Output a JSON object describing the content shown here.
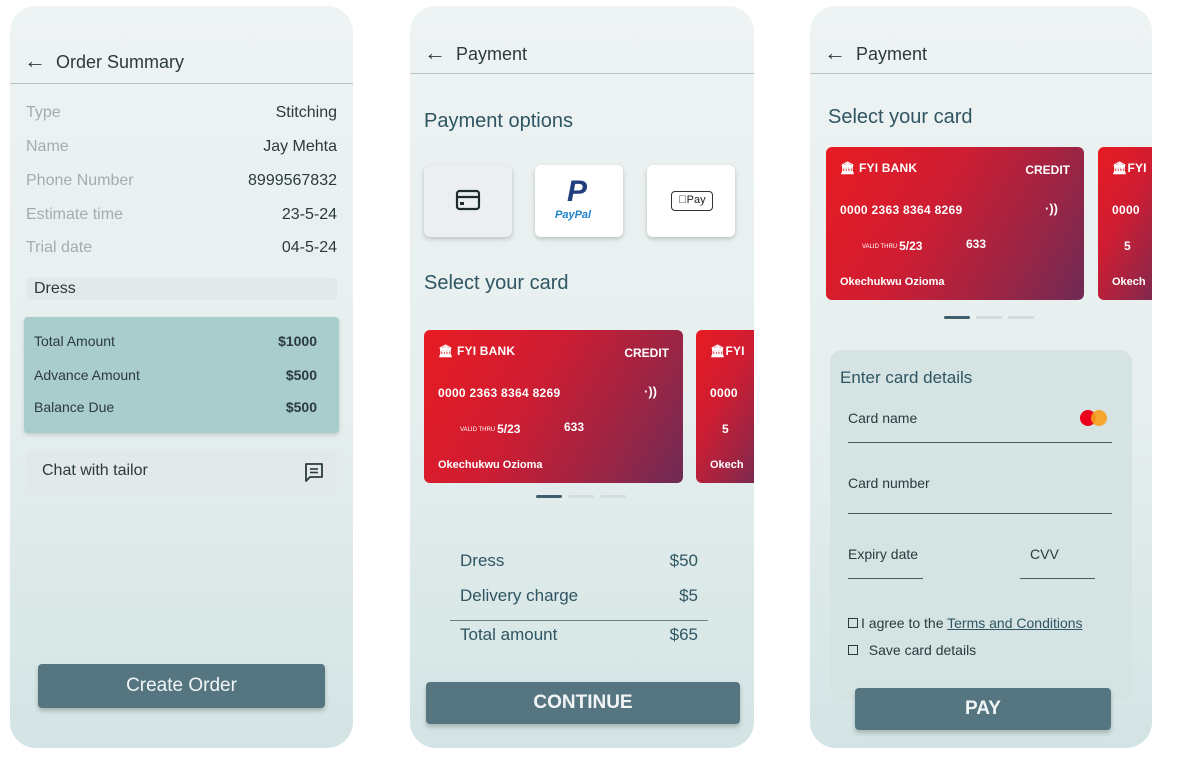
{
  "order_summary": {
    "title": "Order Summary",
    "rows": [
      {
        "label": "Type",
        "value": "Stitching"
      },
      {
        "label": "Name",
        "value": "Jay Mehta"
      },
      {
        "label": "Phone Number",
        "value": "8999567832"
      },
      {
        "label": "Estimate time",
        "value": "23-5-24"
      },
      {
        "label": "Trial date",
        "value": "04-5-24"
      }
    ],
    "item_label": "Dress",
    "amounts": [
      {
        "label": "Total Amount",
        "value": "$1000"
      },
      {
        "label": "Advance Amount",
        "value": "$500"
      },
      {
        "label": "Balance Due",
        "value": "$500"
      }
    ],
    "chat_label": "Chat with tailor",
    "create_button": "Create Order"
  },
  "payment": {
    "title": "Payment",
    "options_title": "Payment options",
    "paypal_text": "PayPal",
    "applepay_text": "Pay",
    "select_card_title": "Select your card",
    "card": {
      "bank": "FYI BANK",
      "type": "CREDIT",
      "number": "0000 2363 8364 8269",
      "valid_label": "VALID THRU",
      "expiry": "5/23",
      "cvv": "633",
      "holder": "Okechukwu Ozioma"
    },
    "peek_card": {
      "bank": "FYI",
      "number": "0000",
      "expiry": "5",
      "holder": "Okech"
    },
    "summary": [
      {
        "label": "Dress",
        "value": "$50"
      },
      {
        "label": "Delivery charge",
        "value": "$5"
      },
      {
        "label": "Total amount",
        "value": "$65"
      }
    ],
    "continue_button": "CONTINUE"
  },
  "card_details": {
    "title": "Payment",
    "select_card_title": "Select your card",
    "peek_card": {
      "bank": "FYI",
      "number": "0000",
      "expiry": "5",
      "holder": "Okech"
    },
    "form_title": "Enter card details",
    "card_name_label": "Card name",
    "card_number_label": "Card number",
    "expiry_label": "Expiry date",
    "cvv_label": "CVV",
    "agree_prefix": "I agree to the ",
    "terms_link": "Terms and Conditions",
    "save_label": "Save card details",
    "pay_button": "PAY"
  },
  "colors": {
    "primary_button": "#557680",
    "amount_box": "#a9cdcd",
    "card_red": "#e81b22",
    "card_purple": "#6e2a55",
    "active_dot": "#3e5f6b",
    "mastercard_red": "#eb001b",
    "mastercard_yellow": "#f79e1b"
  },
  "icons": [
    "back-arrow-icon",
    "chat-icon",
    "card-icon",
    "paypal-icon",
    "apple-pay-icon",
    "bank-icon",
    "nfc-icon",
    "mastercard-icon",
    "checkbox-icon"
  ]
}
